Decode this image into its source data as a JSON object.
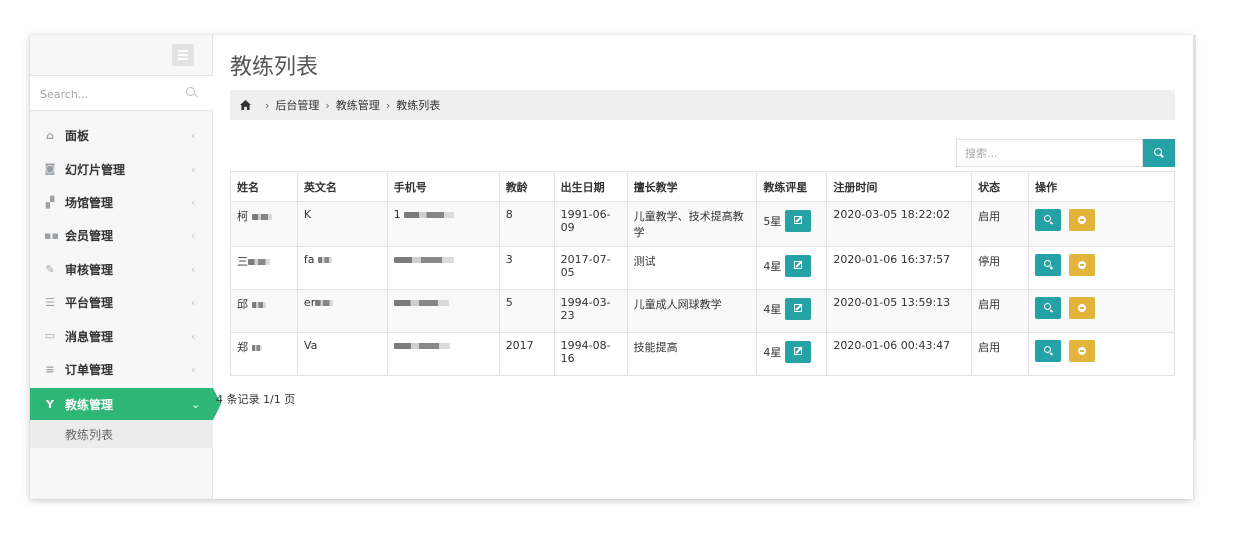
{
  "sidebar": {
    "search_placeholder": "Search...",
    "items": [
      {
        "label": "面板",
        "icon": "home-icon"
      },
      {
        "label": "幻灯片管理",
        "icon": "camera-icon"
      },
      {
        "label": "场馆管理",
        "icon": "venue-icon"
      },
      {
        "label": "会员管理",
        "icon": "users-icon"
      },
      {
        "label": "审核管理",
        "icon": "gavel-icon"
      },
      {
        "label": "平台管理",
        "icon": "sliders-icon"
      },
      {
        "label": "消息管理",
        "icon": "message-icon"
      },
      {
        "label": "订单管理",
        "icon": "list-icon"
      }
    ],
    "active": {
      "label": "教练管理",
      "icon": "coach-icon"
    },
    "sub_item": "教练列表"
  },
  "main": {
    "title": "教练列表",
    "breadcrumb": [
      "后台管理",
      "教练管理",
      "教练列表"
    ],
    "search_placeholder": "搜索...",
    "columns": [
      "姓名",
      "英文名",
      "手机号",
      "教龄",
      "出生日期",
      "擅长教学",
      "教练评星",
      "注册时间",
      "状态",
      "操作"
    ],
    "rows": [
      {
        "name": "柯",
        "english": "K",
        "phone": "1",
        "years": "8",
        "birth": "1991-06-09",
        "speciality": "儿童教学、技术提高教学",
        "rating": "5星",
        "registered": "2020-03-05 18:22:02",
        "status": "启用"
      },
      {
        "name": "三",
        "english": "fa",
        "phone": "",
        "years": "3",
        "birth": "2017-07-05",
        "speciality": "测试",
        "rating": "4星",
        "registered": "2020-01-06 16:37:57",
        "status": "停用"
      },
      {
        "name": "邱",
        "english": "er",
        "phone": "",
        "years": "5",
        "birth": "1994-03-23",
        "speciality": "儿童成人网球教学",
        "rating": "4星",
        "registered": "2020-01-05 13:59:13",
        "status": "启用"
      },
      {
        "name": "郑",
        "english": "Va",
        "phone": "",
        "years": "2017",
        "birth": "1994-08-16",
        "speciality": "技能提高",
        "rating": "4星",
        "registered": "2020-01-06 00:43:47",
        "status": "启用"
      }
    ],
    "record_count": "4 条记录 1/1 页"
  },
  "colors": {
    "accent_green": "#2eb676",
    "teal": "#25a2a5",
    "yellow": "#e2b43c"
  }
}
